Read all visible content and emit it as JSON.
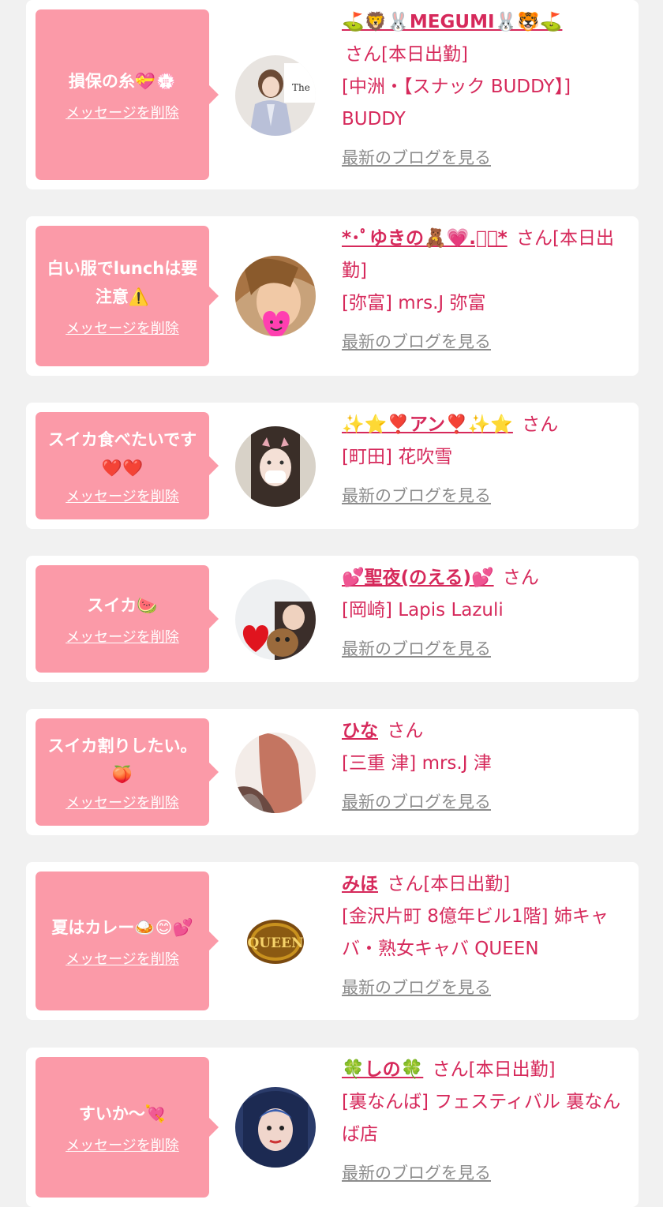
{
  "delete_label": "メッセージを削除",
  "blog_label": "最新のブログを見る",
  "cards": [
    {
      "message": "損保の糸💝💮",
      "name": "⛳🦁🐰MEGUMI🐰🐯⛳",
      "san": "さん[本日出勤]",
      "shop": "[中洲・【スナック BUDDY】] BUDDY",
      "avatar": "avatar-kimono"
    },
    {
      "message": "白い服でlunchは要注意⚠️",
      "name": "*･ﾟゆきの🧸💗.ﾟ･*",
      "san": "さん[本日出勤]",
      "shop": "[弥富] mrs.J 弥富",
      "avatar": "avatar-heart-face"
    },
    {
      "message": "スイカ食べたいです❤️❤️",
      "name": "✨⭐❣️アン❣️✨⭐",
      "san": "さん",
      "shop": "[町田] 花吹雪",
      "avatar": "avatar-mask"
    },
    {
      "message": "スイカ🍉",
      "name": "💕聖夜(のえる)💕",
      "san": "さん",
      "shop": "[岡崎] Lapis Lazuli",
      "avatar": "avatar-dog"
    },
    {
      "message": "スイカ割りしたい。🍑",
      "name": "ひな",
      "san": "さん",
      "shop": "[三重 津] mrs.J 津",
      "avatar": "avatar-red-hair"
    },
    {
      "message": "夏はカレー🍛😊💕",
      "name": "みほ",
      "san": "さん[本日出勤]",
      "shop": "[金沢片町 8億年ビル1階] 姉キャバ・熟女キャバ QUEEN",
      "avatar": "avatar-queen-logo",
      "logo_text": "QUEEN"
    },
    {
      "message": "すいか〜💘",
      "name": "🍀しの🍀",
      "san": "さん[本日出勤]",
      "shop": "[裏なんば] フェスティバル 裏なんば店",
      "avatar": "avatar-selfie"
    }
  ]
}
